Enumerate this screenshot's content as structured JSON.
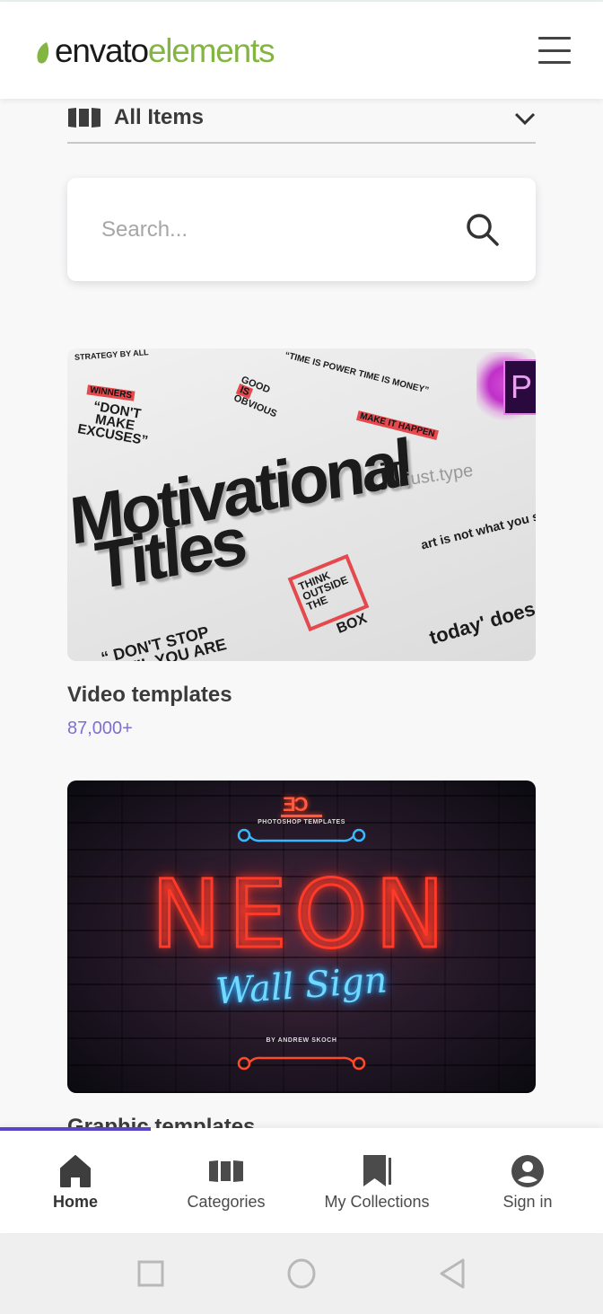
{
  "header": {
    "logo_primary": "envato",
    "logo_secondary": "elements",
    "menu_icon": "hamburger-menu-icon",
    "colors": {
      "logo_green": "#82b541",
      "logo_dark": "#1a1a1a"
    }
  },
  "category_select": {
    "icon": "categories-icon",
    "selected": "All Items",
    "chevron": "chevron-down-icon"
  },
  "search": {
    "placeholder": "Search...",
    "value": "",
    "icon": "search-icon"
  },
  "cards": [
    {
      "title": "Video templates",
      "count": "87,000+",
      "thumbnail": {
        "headline_1": "Motivational",
        "headline_2": "Titles",
        "snippets": [
          "WINNERS",
          "“DON'T MAKE EXCUSES”",
          "THINK OUTSIDE THE",
          "BOX",
          "“ DON'T STOP UNTIL YOU ARE PROUD ”",
          "art is not what you see.",
          "today' does not wait."
        ],
        "brand": "jT",
        "brand_text": "just.type",
        "badge": "P"
      }
    },
    {
      "title": "Graphic templates",
      "count": "",
      "thumbnail": {
        "logo": "ஐஐ",
        "caption_top": "PHOTOSHOP TEMPLATES",
        "headline": "NEON",
        "script": "Wall Sign",
        "caption_bottom": "BY ANDREW SKOCH"
      }
    }
  ],
  "bottom_nav": {
    "active_index": 0,
    "items": [
      {
        "label": "Home",
        "icon": "home-icon"
      },
      {
        "label": "Categories",
        "icon": "categories-icon"
      },
      {
        "label": "My Collections",
        "icon": "bookmark-icon"
      },
      {
        "label": "Sign in",
        "icon": "account-circle-icon"
      }
    ],
    "accent": "#5a44c8"
  },
  "system_nav": {
    "buttons": [
      "recents",
      "home",
      "back"
    ]
  },
  "accent_colors": {
    "count_purple": "#7f6fd0"
  }
}
